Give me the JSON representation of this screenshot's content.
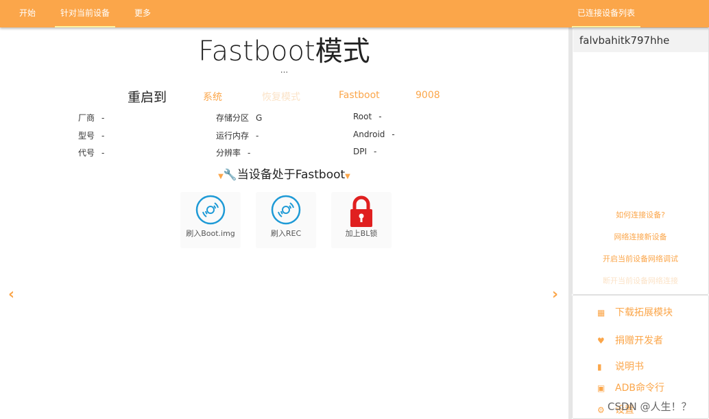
{
  "nav": {
    "start": "开始",
    "current_device": "针对当前设备",
    "more": "更多",
    "connected_list": "已连接设备列表"
  },
  "main": {
    "title": "Fastboot模式",
    "subtitle": "...",
    "reboot_label": "重启到",
    "reboot_options": [
      "系统",
      "恢复模式",
      "Fastboot",
      "9008"
    ],
    "info": {
      "vendor_label": "厂商",
      "vendor_value": "-",
      "model_label": "型号",
      "model_value": "-",
      "codename_label": "代号",
      "codename_value": "-",
      "storage_label": "存储分区",
      "storage_value": "G",
      "ram_label": "运行内存",
      "ram_value": "-",
      "resolution_label": "分辨率",
      "resolution_value": "-",
      "root_label": "Root",
      "root_value": "-",
      "android_label": "Android",
      "android_value": "-",
      "dpi_label": "DPI",
      "dpi_value": "-"
    },
    "section_title": "当设备处于Fastboot",
    "actions": [
      {
        "label": "刷入Boot.img",
        "icon": "disc-icon"
      },
      {
        "label": "刷入REC",
        "icon": "disc-icon"
      },
      {
        "label": "加上BL锁",
        "icon": "lock-icon"
      }
    ],
    "colors": {
      "accent": "#fba64a",
      "disc": "#1e9ad6",
      "lock": "#e02020"
    }
  },
  "sidebar": {
    "devices": [
      "falvbahitk797hhe"
    ],
    "links": [
      "如何连接设备?",
      "网络连接新设备",
      "开启当前设备网络调试",
      "断开当前设备网络连接"
    ],
    "menu": [
      {
        "label": "下载拓展模块",
        "icon": "grid-icon"
      },
      {
        "label": "捐赠开发者",
        "icon": "heart-icon"
      },
      {
        "label": "说明书",
        "icon": "book-icon"
      },
      {
        "label": "ADB命令行",
        "icon": "terminal-icon"
      },
      {
        "label": "设置",
        "icon": "gear-icon"
      }
    ]
  },
  "watermark": "CSDN @人生！？"
}
